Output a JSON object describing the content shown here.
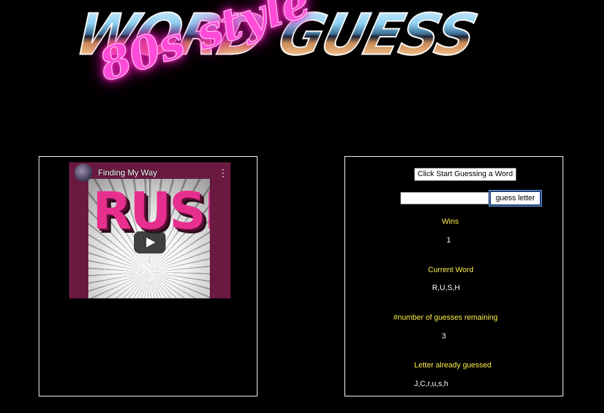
{
  "logo": {
    "title": "WORD GUESS",
    "subtitle": "80s style"
  },
  "video": {
    "channel_title": "Finding My Way",
    "album_art_text": "RUSH",
    "menu_icon": "vertical-dots-icon",
    "play_icon": "play-icon"
  },
  "game": {
    "start_button": "Click Start Guessing a Word",
    "input_value": "",
    "guess_button": "guess letter",
    "wins_label": "Wins",
    "wins_value": "1",
    "current_word_label": "Current Word",
    "current_word_value": "R,U,S,H",
    "guesses_remaining_label": "#number of guesses remaining",
    "guesses_remaining_value": "3",
    "letters_guessed_label": "Letter already guessed",
    "letters_guessed_value": "J,C,r,u,s,h"
  },
  "colors": {
    "background": "#000000",
    "label": "#ffef4a",
    "value": "#ffffff",
    "neon_pink": "#ff3fd0"
  }
}
